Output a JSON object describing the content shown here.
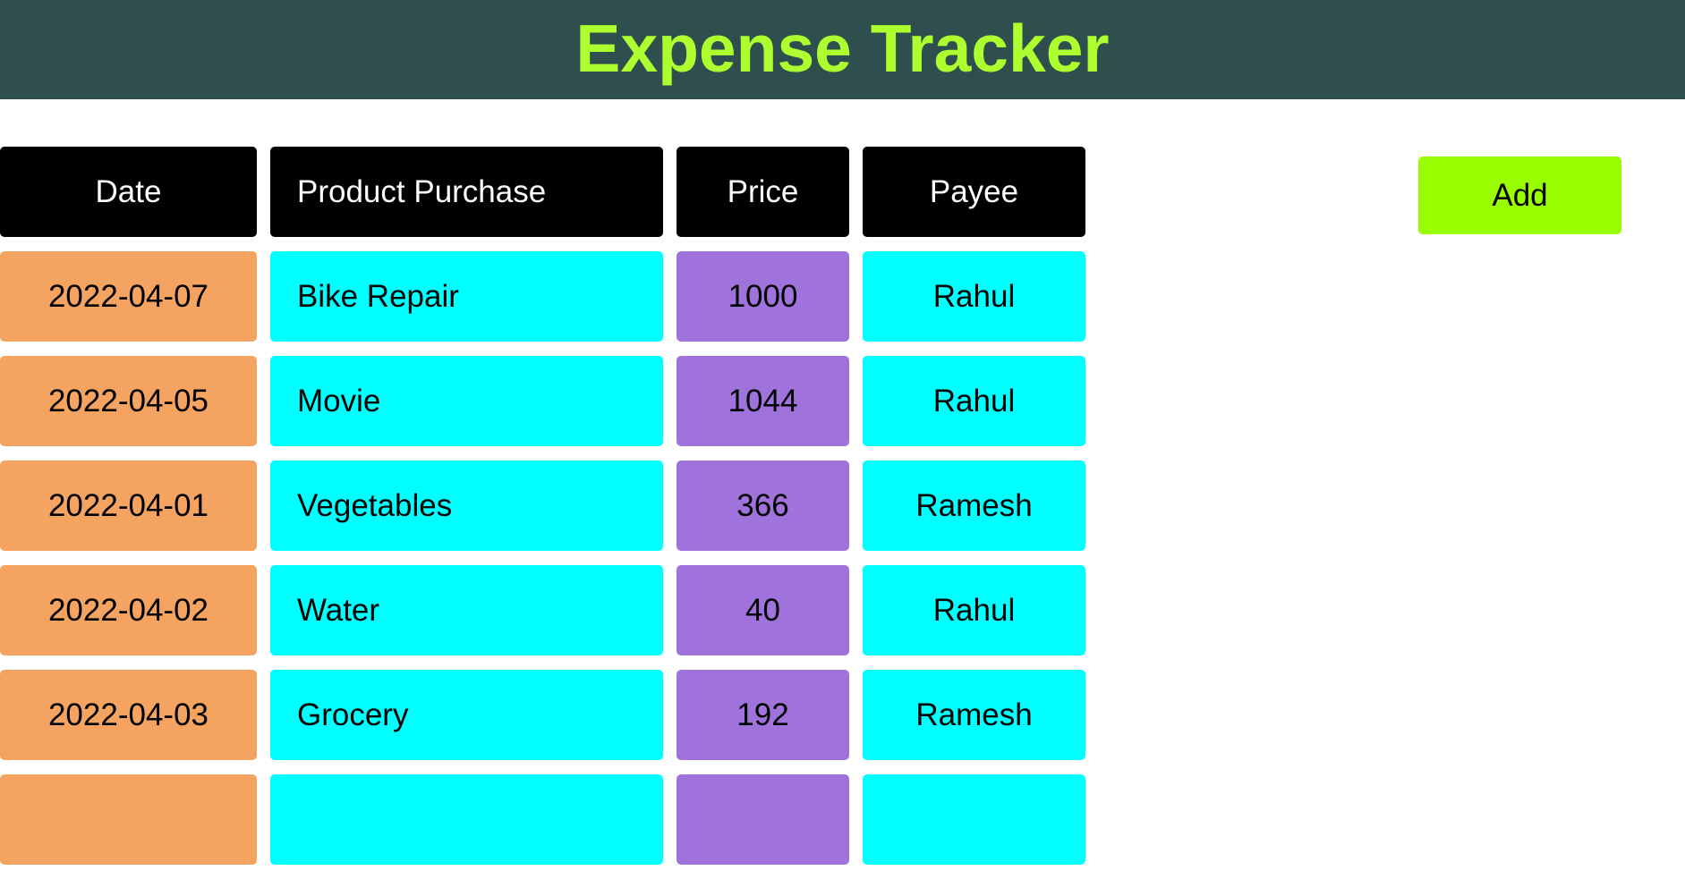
{
  "header": {
    "title": "Expense Tracker"
  },
  "actions": {
    "add_label": "Add"
  },
  "table": {
    "columns": [
      "Date",
      "Product Purchase",
      "Price",
      "Payee"
    ],
    "rows": [
      {
        "date": "2022-04-07",
        "product": "Bike Repair",
        "price": "1000",
        "payee": "Rahul"
      },
      {
        "date": "2022-04-05",
        "product": "Movie",
        "price": "1044",
        "payee": "Rahul"
      },
      {
        "date": "2022-04-01",
        "product": "Vegetables",
        "price": "366",
        "payee": "Ramesh"
      },
      {
        "date": "2022-04-02",
        "product": "Water",
        "price": "40",
        "payee": "Rahul"
      },
      {
        "date": "2022-04-03",
        "product": "Grocery",
        "price": "192",
        "payee": "Ramesh"
      },
      {
        "date": "",
        "product": "",
        "price": "",
        "payee": ""
      }
    ]
  },
  "colors": {
    "header_bg": "#2f4f4f",
    "title": "#adff2f",
    "add_button": "#99ff00",
    "column_header_bg": "#000000",
    "date_cell": "#f4a460",
    "product_cell": "#00ffff",
    "price_cell": "#a073dc",
    "payee_cell": "#00ffff"
  }
}
